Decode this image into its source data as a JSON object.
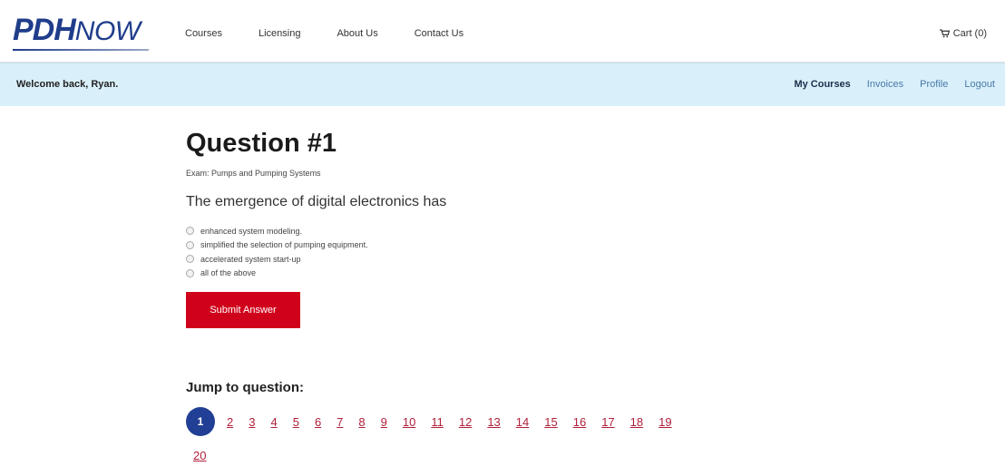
{
  "brand": {
    "logo_bold": "PDH",
    "logo_light": "NOW"
  },
  "nav": {
    "items": [
      "Courses",
      "Licensing",
      "About Us",
      "Contact Us"
    ]
  },
  "cart": {
    "label": "Cart (0)"
  },
  "welcome": {
    "text": "Welcome back, Ryan."
  },
  "user_nav": {
    "my_courses": "My Courses",
    "invoices": "Invoices",
    "profile": "Profile",
    "logout": "Logout"
  },
  "question": {
    "title": "Question #1",
    "exam": "Exam: Pumps and Pumping Systems",
    "text": "The emergence of digital electronics has",
    "options": [
      "enhanced system modeling.",
      "simplified the selection of pumping equipment.",
      "accelerated system start-up",
      "all of the above"
    ],
    "submit_label": "Submit Answer"
  },
  "jump": {
    "title": "Jump to question:",
    "current": "1",
    "row1": [
      "2",
      "3",
      "4",
      "5",
      "6",
      "7",
      "8",
      "9",
      "10",
      "11",
      "12",
      "13",
      "14",
      "15",
      "16",
      "17",
      "18",
      "19"
    ],
    "row2": [
      "20"
    ]
  },
  "colors": {
    "brand_blue": "#1f3d8a",
    "welcome_bar": "#d9f0fb",
    "submit_red": "#d0021b",
    "current_page": "#213f94",
    "page_link": "#b0203a"
  }
}
